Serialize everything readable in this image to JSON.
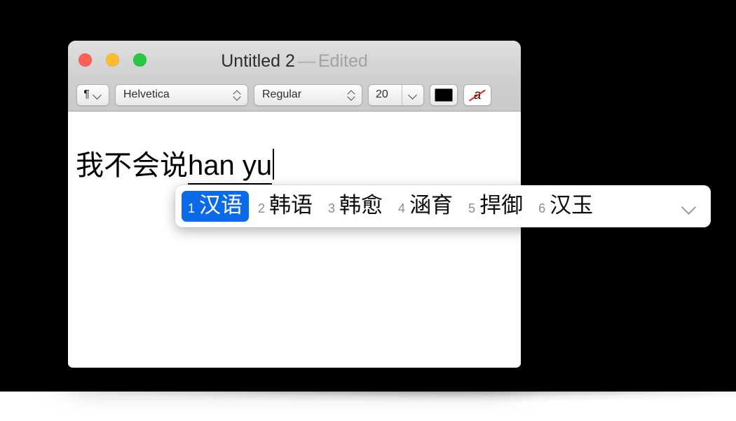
{
  "window": {
    "title": "Untitled 2",
    "dash": "—",
    "edit_state": "Edited",
    "traffic_lights": [
      {
        "name": "close",
        "color": "#ff5f57"
      },
      {
        "name": "minimize",
        "color": "#febc2e"
      },
      {
        "name": "zoom",
        "color": "#28c840"
      }
    ]
  },
  "toolbar": {
    "paragraph_style_glyph": "¶",
    "font_family": "Helvetica",
    "font_style": "Regular",
    "font_size": "20",
    "text_color": "#000000",
    "no_color_glyph": "a",
    "slash_color": "#e8261c"
  },
  "document": {
    "committed_text": "我不会说",
    "composing_text": "han yu"
  },
  "ime": {
    "accent_color": "#0a6ae8",
    "candidates": [
      {
        "index": "1",
        "word": "汉语",
        "selected": true
      },
      {
        "index": "2",
        "word": "韩语",
        "selected": false
      },
      {
        "index": "3",
        "word": "韩愈",
        "selected": false
      },
      {
        "index": "4",
        "word": "涵育",
        "selected": false
      },
      {
        "index": "5",
        "word": "捍御",
        "selected": false
      },
      {
        "index": "6",
        "word": "汉玉",
        "selected": false
      }
    ]
  }
}
